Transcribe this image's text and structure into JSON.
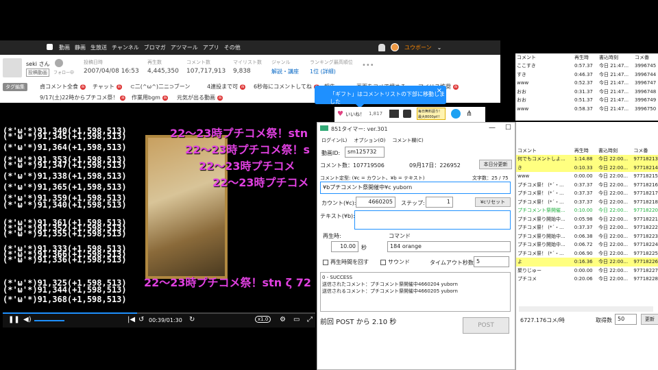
{
  "header": {
    "nav": [
      "動画",
      "静画",
      "生放送",
      "チャンネル",
      "ブロマガ",
      "アツマール",
      "アプリ",
      "その他"
    ],
    "user_name": "ユウボーン"
  },
  "video_info": {
    "owner": "seki さん",
    "owner_tag": "投稿動画",
    "follow": "フォロー中",
    "stats": [
      {
        "label": "投稿日時",
        "value": "2007/04/08 16:53"
      },
      {
        "label": "再生数",
        "value": "4,445,350"
      },
      {
        "label": "コメント数",
        "value": "107,717,913"
      },
      {
        "label": "マイリスト数",
        "value": "9,838"
      },
      {
        "label": "ジャンル",
        "value": "解説・講座"
      },
      {
        "label": "ランキング最高順位",
        "value": "1位 (詳細)"
      }
    ]
  },
  "tags": {
    "edit_label": "タグ編集",
    "items": [
      "貞コメント全食",
      "チャット",
      "⊂二(^ω^)二ニ⊃ブーン",
      "4連投まで可",
      "6秒毎にコメントしてね",
      "報告",
      "画面をコメで埋めろ",
      "マイリス推奨",
      "9/17(土)22時からプチコメ祭！",
      "作業用bgm",
      "元気が出る動画"
    ]
  },
  "gift_tip": "「ギフト」はコメントリストの下部に移動しました",
  "like": {
    "label": "いいね！",
    "count": "1,817",
    "ad": "毎日無料語り! 最大8000pt!!"
  },
  "player": {
    "comments": [
      "(*'ω'*)91,340(+1,598,513)",
      "(*'ω'*)91,345(+1,598,513)",
      "(*'ω'*)91,364(+1,598,513)",
      "(*'ω'*)91,353(+1,598,513)",
      "(*'ω'*)91,347(+1,598,513)",
      "(*'ω'*)91,338(+1,598,513)",
      "(*'ω'*)91,365(+1,598,513)",
      "(*'ω'*)91,359(+1,598,513)",
      "(*'ω'*)91,340(+1,598,513)",
      "(*'ω'*)91,361(+1,598,513)",
      "(*'ω'*)91,352(+1,598,513)",
      "(*'ω'*)91,355(+1,598,513)",
      "(*'ω'*)91,333(+1,598,513)",
      "(*'ω'*)91,366(+1,598,513)",
      "(*'ω'*)91,336(+1,598,513)",
      "(*'ω'*)91,325(+1,598,513)",
      "(*'ω'*)91,344(+1,598,513)",
      "(*'ω'*)91,368(+1,598,513)"
    ],
    "pink": [
      "22～23時プチコメ祭！stn",
      "22～23時プチコメ祭！s",
      "22～23時プチコメ",
      "22～23時プチコメ",
      "22～23時プチコメ祭！stn ζ 72"
    ],
    "time": "00:39/01:30",
    "progress": 0.43,
    "speed": "x1.0"
  },
  "timer": {
    "title": "851タイマー: ver.301",
    "menu": [
      "ログイン(L)",
      "オプション(O)",
      "コメント欄(C)"
    ],
    "video_id_label": "動画ID:",
    "video_id": "sm125732",
    "comment_count": "コメント数：107719506",
    "date_count": "09月17日：226952",
    "today_btn": "本日分更新",
    "def_label": "コメント定型: (¥c = カウント、¥b = テキスト)",
    "char_count": "文字数：25 / 75",
    "template": "¥bプチコメント祭開催中¥c yuborn",
    "count_label": "カウント(¥c):",
    "count_val": "4660205",
    "step_label": "ステップ:",
    "step_val": "1",
    "reset_btn": "¥cリセット",
    "text_label": "テキスト(¥b):",
    "play_label": "再生時:",
    "play_val": "10.00",
    "sec": "秒",
    "cmd_label": "コマンド",
    "cmd_val": "184 orange",
    "loop_label": "再生時間を回す",
    "sound_label": "サウンド",
    "timeout_label": "タイムアウト秒数",
    "timeout_val": "5",
    "log": [
      "0 - SUCCESS",
      "送信されたコメント：プチコメント祭開催中4660204 yuborn",
      "送信されるコメント：プチコメント祭開催中4660205 yuborn"
    ],
    "last_post": "前回 POST から 2.10 秒",
    "post_btn": "POST"
  },
  "top_panel": {
    "headers": [
      "コメント",
      "再生時",
      "書込時刻",
      "コメ番"
    ],
    "rows": [
      [
        "ここすき",
        "0:57.37",
        "今日 21:47...",
        "3996745"
      ],
      [
        "すき",
        "0:46.37",
        "今日 21:47...",
        "3996744"
      ],
      [
        "www",
        "0:52.37",
        "今日 21:47...",
        "3996747"
      ],
      [
        "おお",
        "0:31.37",
        "今日 21:47...",
        "3996748"
      ],
      [
        "おお",
        "0:51.37",
        "今日 21:47...",
        "3996749"
      ],
      [
        "www",
        "0:58.37",
        "今日 21:47...",
        "3996750"
      ]
    ]
  },
  "win2": {
    "headers": [
      "コメント",
      "再生時",
      "書込時刻",
      "コメ番"
    ],
    "rows": [
      {
        "c": [
          "何でもコメントしよ...",
          "1:14.88",
          "今日 22:00...",
          "97718213"
        ],
        "s": "hl"
      },
      {
        "c": [
          "き",
          "0:10.33",
          "今日 22:00...",
          "97718214"
        ],
        "s": "hl"
      },
      {
        "c": [
          "www",
          "0:00.00",
          "今日 22:00...",
          "97718215"
        ],
        "s": ""
      },
      {
        "c": [
          "プチコメ祭！ (*´・...",
          "0:37.37",
          "今日 22:00...",
          "97718216"
        ],
        "s": ""
      },
      {
        "c": [
          "プチコメ祭！ (*´・...",
          "0:37.37",
          "今日 22:00...",
          "97718217"
        ],
        "s": ""
      },
      {
        "c": [
          "プチコメ祭！ (*´・...",
          "0:37.37",
          "今日 22:00...",
          "97718218"
        ],
        "s": ""
      },
      {
        "c": [
          "プチコメント祭開催...",
          "0:10.00",
          "今日 22:00...",
          "97718220"
        ],
        "s": "gr"
      },
      {
        "c": [
          "プチコメ祭り開始中...",
          "0:05.98",
          "今日 22:00...",
          "97718221"
        ],
        "s": ""
      },
      {
        "c": [
          "プチコメ祭！ (*´・...",
          "0:37.37",
          "今日 22:00...",
          "97718222"
        ],
        "s": ""
      },
      {
        "c": [
          "プチコメ祭り開始中...",
          "0:06.38",
          "今日 22:00...",
          "97718223"
        ],
        "s": ""
      },
      {
        "c": [
          "プチコメ祭り開始中...",
          "0:06.72",
          "今日 22:00...",
          "97718224"
        ],
        "s": ""
      },
      {
        "c": [
          "プチコメ祭！ (*´・...",
          "0:06.90",
          "今日 22:00...",
          "97718225"
        ],
        "s": ""
      },
      {
        "c": [
          "よ",
          "0:16.36",
          "今日 22:00...",
          "97718226"
        ],
        "s": "hl"
      },
      {
        "c": [
          "聚りじゅー",
          "0:00.00",
          "今日 22:00...",
          "97718227"
        ],
        "s": ""
      },
      {
        "c": [
          "プチコメ",
          "0:20.06",
          "今日 22:00...",
          "97718228"
        ],
        "s": ""
      }
    ],
    "rate": "6727.176コメ/時",
    "fetch_label": "取得数",
    "fetch_val": "50",
    "update_btn": "更新"
  }
}
